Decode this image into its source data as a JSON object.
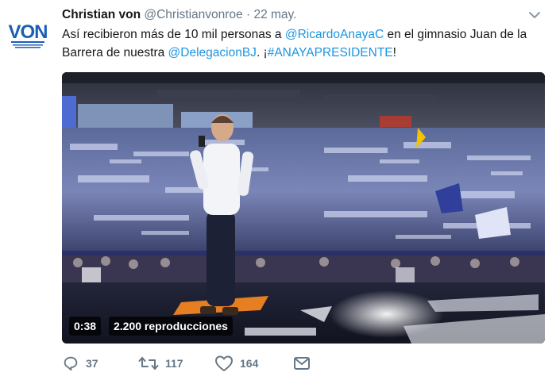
{
  "author": {
    "name": "Christian von",
    "handle": "@Christianvonroe",
    "separator": "·",
    "date": "22 may.",
    "avatar_text": "VON",
    "avatar_tag": "CHRISTIAN"
  },
  "tweet": {
    "part1": "Así recibieron más de 10 mil personas a ",
    "mention1": "@RicardoAnayaC",
    "part2": " en el gimnasio Juan de la Barrera de nuestra ",
    "mention2": "@DelegacionBJ",
    "part3": ". ¡",
    "hashtag": "#ANAYAPRESIDENTE",
    "part4": "!"
  },
  "video": {
    "duration": "0:38",
    "views": "2.200 reproducciones"
  },
  "actions": {
    "replies": "37",
    "retweets": "117",
    "likes": "164"
  },
  "colors": {
    "link": "#1b95e0",
    "muted": "#657786",
    "brand_blue": "#1a5fb4"
  },
  "icons": [
    "chevron-down-icon",
    "reply-icon",
    "retweet-icon",
    "heart-icon",
    "mail-icon"
  ]
}
